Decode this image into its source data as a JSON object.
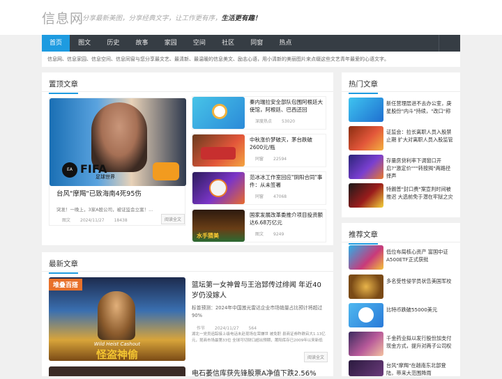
{
  "site": {
    "name": "信息网",
    "slogan_light": "分享最新美图，分享经典文字，让工作更有序，",
    "slogan_bold": "生活更有趣！"
  },
  "nav": [
    "首页",
    "图文",
    "历史",
    "故事",
    "家园",
    "空间",
    "社区",
    "同窗",
    "热点"
  ],
  "notice": "信息网、信息家园、信息空间、信息同窗与您分享最文艺、最清新、最温暖的信息美文、励志心语，用小清新的美丽图片来点缀这些文艺青年最爱的心语文字。",
  "featured": {
    "title": "置顶文章",
    "main": {
      "title": "台风\"摩羯\"已致海南4死95伤",
      "summary": "突发！一晚上，3家A股公司，被证监会立案！...",
      "category": "图文",
      "date": "2024/11/27",
      "views": "18438",
      "more": "阅读全文",
      "fifa_text": "FIFA",
      "fifa_sub": "足球世界"
    },
    "list": [
      {
        "title": "秦内瑞拉安全部队包围阿根廷大使馆，阿根廷、巴西还回",
        "category": "深度热点",
        "views": "53020"
      },
      {
        "title": "中秋涨价梦破灭，茅台跌破2600元/瓶",
        "category": "同窗",
        "views": "22594"
      },
      {
        "title": "范冰冰工作室回应\"阴阳合同\"事件：从未签署",
        "category": "同窗",
        "views": "47068"
      },
      {
        "title": "国家发展改革委推介项目投资额达6.68万亿元",
        "category": "图文",
        "views": "9249",
        "thumb_text": "水手猜美"
      }
    ]
  },
  "latest": {
    "title": "最新文章",
    "item": {
      "title": "篮坛第一女神曾与王治郅传过绯闻 年近40岁仍没嫁人",
      "summary": "标普预测：2024年中国激光雷达企业市场销量占比预计将超过90%",
      "category": "作节",
      "date": "2024/11/27",
      "views": "564",
      "excerpt": "湖北一党员追踪接上级电话未赴现场在荣嫌世 被免职 县商证券昨跌宕大1.13亿元，昆商市场最第33位 全球可切财口超出预期，莆阳库存已2009年以来新低",
      "more": "阅读全文",
      "banner": "堆叠百搭",
      "game_en": "Wild Heist Cashout",
      "game_cn": "怪盗神偷"
    },
    "next_title": "电石萎信库获先锋股票A净值下跌2.56%"
  },
  "hot": {
    "title": "热门文章",
    "items": [
      "新任营理层进不去办公室，庚星股份\"内斗\"持续，\"改口\"称",
      "证监会：拉长离职人员入股禁止期 扩大对离职人员入股监管",
      "存量房贷利率下调窗口开启?\"激定价\"\"\"转按揭\"两路径择声",
      "特朗普\"封口费\"案宣判时间被推迟 大选前免于潜在牢狱之灾"
    ]
  },
  "recommend": {
    "title": "推荐文章",
    "items": [
      "低位布局核心资产 富国中证A500ETF正式获批",
      "多名受性侵学员状告美国军校",
      "比特币跌破55000美元",
      "千金药业拟以发行股份加支付现金方式，提升对两子公司权",
      "台风\"摩羯\"在越南东北部登陆，带来大范围降雨"
    ]
  },
  "colors": {
    "accent": "#1e9be0",
    "nav_bg": "#363d44"
  }
}
